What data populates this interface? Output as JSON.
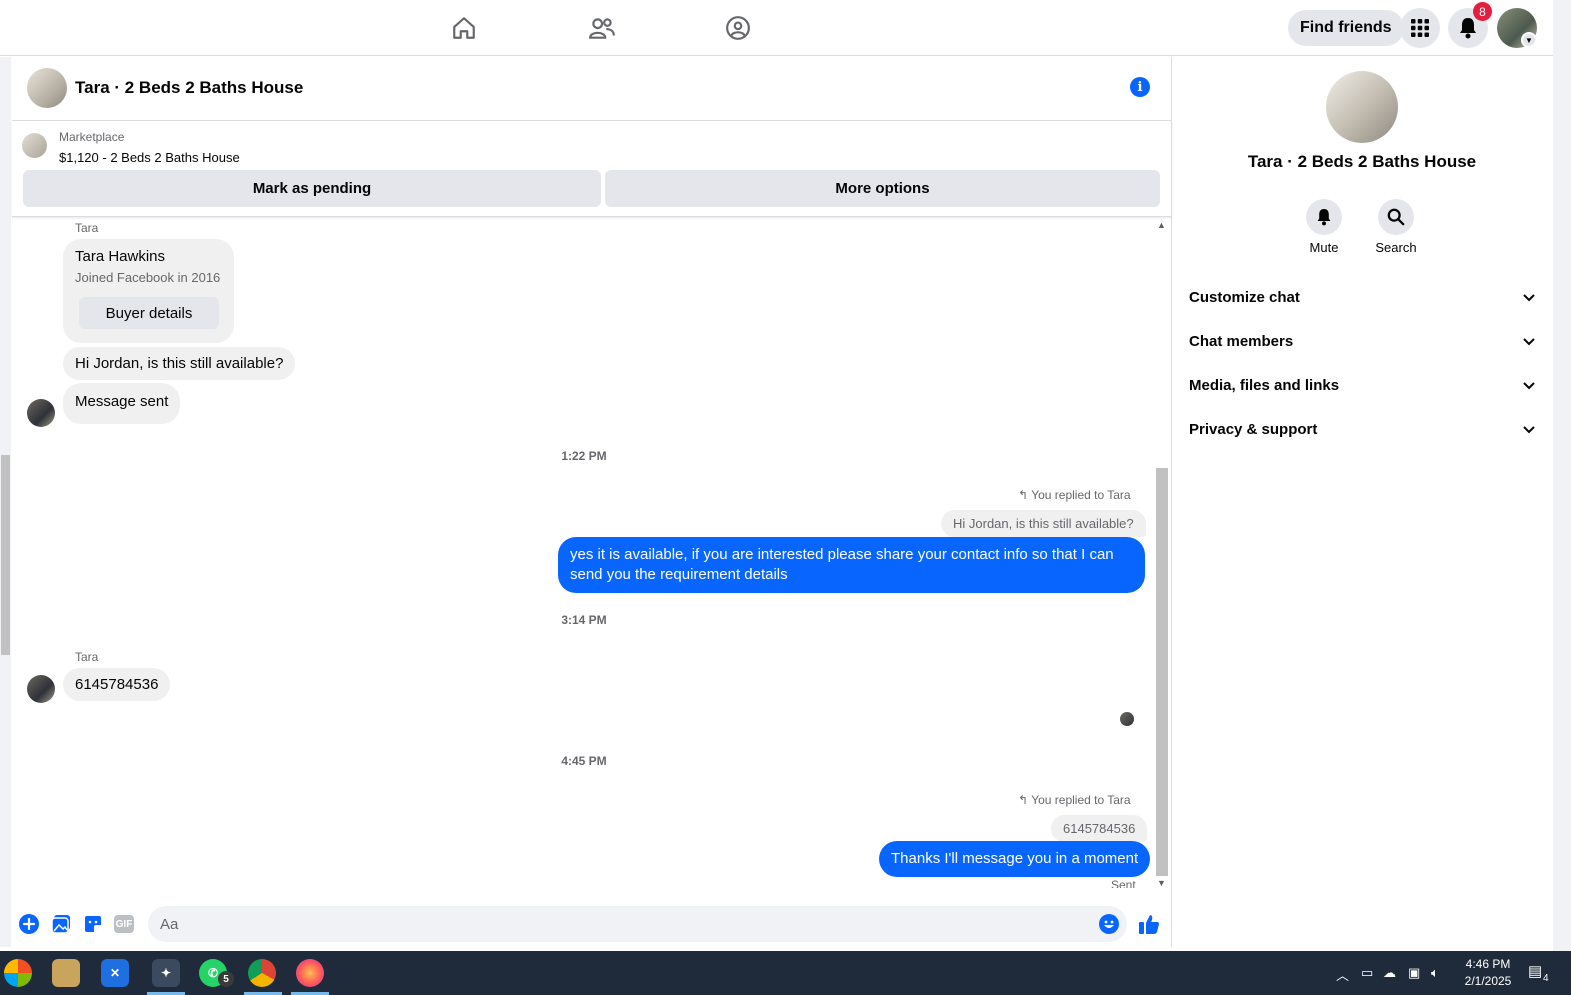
{
  "topnav": {
    "find_friends": "Find friends",
    "notification_count": "8",
    "icons": [
      "home-icon",
      "friends-icon",
      "groups-icon",
      "menu-grid-icon",
      "bell-icon"
    ]
  },
  "chat": {
    "title": "Tara · 2 Beds 2 Baths House",
    "marketplace_label": "Marketplace",
    "listing": "$1,120 - 2 Beds 2 Baths House",
    "mark_pending": "Mark as pending",
    "more_options": "More options",
    "buyer": {
      "sender": "Tara",
      "name": "Tara Hawkins",
      "joined": "Joined Facebook in 2016",
      "button": "Buyer details"
    },
    "msg1": "Hi Jordan, is this still available?",
    "msg2": "Message sent",
    "ts1": "1:22 PM",
    "replied1": "You replied to Tara",
    "quote1": "Hi Jordan, is this still available?",
    "out1_line1": "yes it is available, if you are interested please share your contact info so that I can",
    "out1_line2": "send you the requirement details",
    "ts2": "3:14 PM",
    "sender2": "Tara",
    "msg3": "6145784536",
    "ts3": "4:45 PM",
    "replied2": "You replied to Tara",
    "quote2": "6145784536",
    "out2": "Thanks I'll message you in a moment",
    "status": "Sent",
    "composer_placeholder": "Aa",
    "gif_label": "GIF"
  },
  "right_panel": {
    "name": "Tara · 2 Beds 2 Baths House",
    "mute": "Mute",
    "search": "Search",
    "rows": [
      "Customize chat",
      "Chat members",
      "Media, files and links",
      "Privacy & support"
    ]
  },
  "taskbar": {
    "time": "4:46 PM",
    "date": "2/1/2025",
    "whatsapp_badge": "5",
    "notif_badge": "4"
  },
  "colors": {
    "accent": "#0866ff",
    "bubble_in": "#f0f0f0",
    "badge": "#e41e3f",
    "taskbar": "#1f2b3a"
  }
}
